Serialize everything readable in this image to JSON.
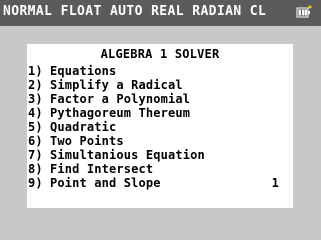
{
  "status_bar": {
    "text": "NORMAL FLOAT AUTO REAL RADIAN CL",
    "battery_icon": "battery-icon"
  },
  "menu": {
    "title": "ALGEBRA 1 SOLVER",
    "items": [
      {
        "number": "1)",
        "label": "Equations"
      },
      {
        "number": "2)",
        "label": "Simplify a Radical"
      },
      {
        "number": "3)",
        "label": "Factor a Polynomial"
      },
      {
        "number": "4)",
        "label": "Pythagoreum Thereum"
      },
      {
        "number": "5)",
        "label": "Quadratic"
      },
      {
        "number": "6)",
        "label": "Two Points"
      },
      {
        "number": "7)",
        "label": "Simultanious Equation"
      },
      {
        "number": "8)",
        "label": "Find Intersect"
      },
      {
        "number": "9)",
        "label": "Point and Slope"
      }
    ],
    "page_indicator": "1"
  },
  "colors": {
    "status_bg": "#5b5b5b",
    "status_text": "#ffffff",
    "screen_bg": "#c8c8c8",
    "panel_bg": "#ffffff",
    "text": "#000000"
  }
}
